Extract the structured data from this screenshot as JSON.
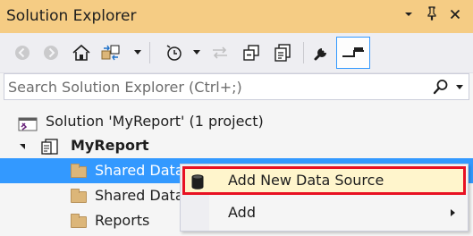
{
  "window": {
    "title": "Solution Explorer",
    "controls": [
      "chevron-down-icon",
      "pin-icon",
      "close-icon"
    ]
  },
  "toolbar": {
    "tools": [
      "back-icon",
      "forward-icon",
      "home-icon",
      "switch-views-icon",
      "pending-changes-filter-icon",
      "sync-icon",
      "collapse-all-icon",
      "show-all-files-icon",
      "properties-icon",
      "preview-selected-items-icon"
    ]
  },
  "search": {
    "placeholder": "Search Solution Explorer (Ctrl+;)",
    "icon": "search-icon"
  },
  "tree": {
    "solution": "Solution 'MyReport' (1 project)",
    "project": "MyReport",
    "items": [
      {
        "label": "Shared Data Sources",
        "icon": "folder-icon",
        "selected": true
      },
      {
        "label": "Shared Datasets",
        "icon": "folder-icon",
        "selected": false
      },
      {
        "label": "Reports",
        "icon": "folder-icon",
        "selected": false
      }
    ]
  },
  "context_menu": {
    "items": [
      {
        "label": "Add New Data Source",
        "icon": "database-icon",
        "highlighted": true
      },
      {
        "label": "Add",
        "submenu": true
      }
    ]
  },
  "colors": {
    "title_bar": "#f5cc84",
    "selection": "#3399ff",
    "highlight_border": "#e81123",
    "highlight_fill": "#fff5cc"
  }
}
